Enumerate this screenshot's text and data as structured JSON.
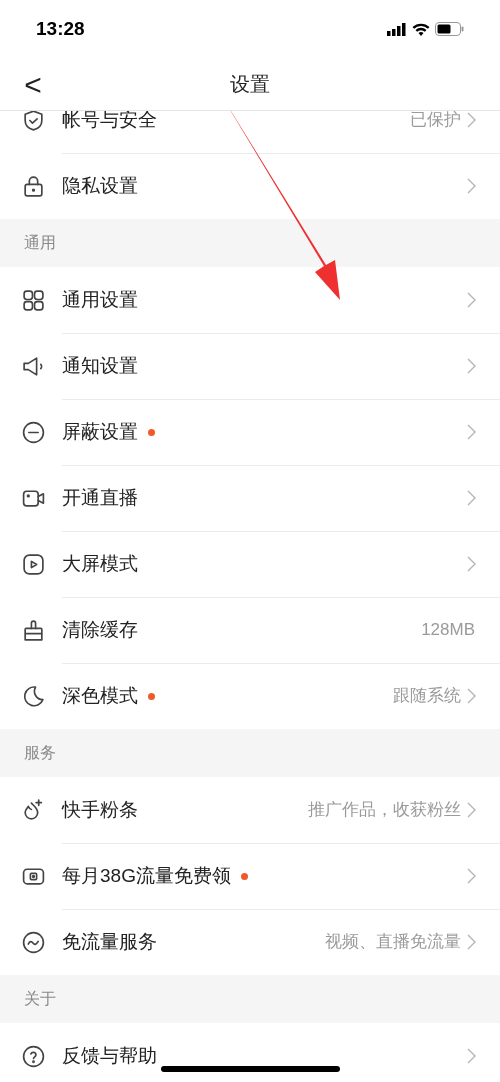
{
  "status_bar": {
    "time": "13:28"
  },
  "nav": {
    "back": "<",
    "title": "设置"
  },
  "sections": [
    {
      "items": [
        {
          "kind": "shield",
          "label": "帐号与安全",
          "value": "已保护",
          "chevron": true,
          "dot": false
        },
        {
          "kind": "lock",
          "label": "隐私设置",
          "chevron": true,
          "dot": false
        }
      ]
    },
    {
      "header": "通用",
      "items": [
        {
          "kind": "grid",
          "label": "通用设置",
          "chevron": true,
          "dot": false
        },
        {
          "kind": "speaker",
          "label": "通知设置",
          "chevron": true,
          "dot": false
        },
        {
          "kind": "minus",
          "label": "屏蔽设置",
          "chevron": true,
          "dot": true
        },
        {
          "kind": "camera",
          "label": "开通直播",
          "chevron": true,
          "dot": false
        },
        {
          "kind": "play",
          "label": "大屏模式",
          "chevron": true,
          "dot": false
        },
        {
          "kind": "brush",
          "label": "清除缓存",
          "value": "128MB",
          "chevron": false,
          "dot": false
        },
        {
          "kind": "moon",
          "label": "深色模式",
          "value": "跟随系统",
          "chevron": true,
          "dot": true
        }
      ]
    },
    {
      "header": "服务",
      "items": [
        {
          "kind": "flame",
          "label": "快手粉条",
          "value": "推广作品，收获粉丝",
          "chevron": true,
          "dot": false
        },
        {
          "kind": "card",
          "label": "每月38G流量免费领",
          "chevron": true,
          "dot": true
        },
        {
          "kind": "wave",
          "label": "免流量服务",
          "value": "视频、直播免流量",
          "chevron": true,
          "dot": false
        }
      ]
    },
    {
      "header": "关于",
      "items": [
        {
          "kind": "question",
          "label": "反馈与帮助",
          "chevron": true,
          "dot": false
        }
      ]
    }
  ]
}
